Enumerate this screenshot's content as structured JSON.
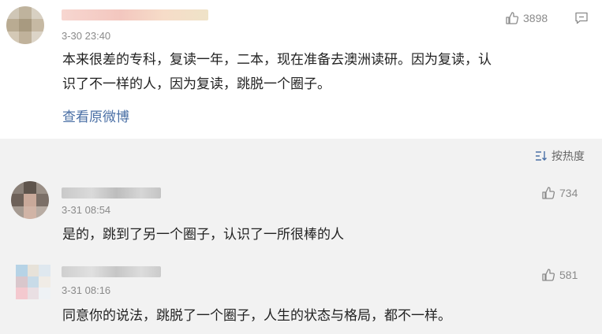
{
  "main_comment": {
    "time": "3-30 23:40",
    "likes": "3898",
    "text_lines": [
      "本来很差的专科，复读一年，二本，现在准备去澳洲读研。因为复读，认",
      "识了不一样的人，因为复读，跳脱一个圈子。"
    ],
    "view_original": "查看原微博"
  },
  "sort": {
    "label": "按热度"
  },
  "replies": [
    {
      "time": "3-31 08:54",
      "likes": "734",
      "text": "是的，跳到了另一个圈子，认识了一所很棒的人"
    },
    {
      "time": "3-31 08:16",
      "likes": "581",
      "text": "同意你的说法，跳脱了一个圈子，人生的状态与格局，都不一样。"
    }
  ],
  "colors": {
    "link": "#4a6fa5",
    "meta": "#8a8a8a",
    "band": "#f2f2f2",
    "text": "#222222"
  },
  "icons": [
    "thumbs-up-icon",
    "reply-icon",
    "sort-icon"
  ]
}
